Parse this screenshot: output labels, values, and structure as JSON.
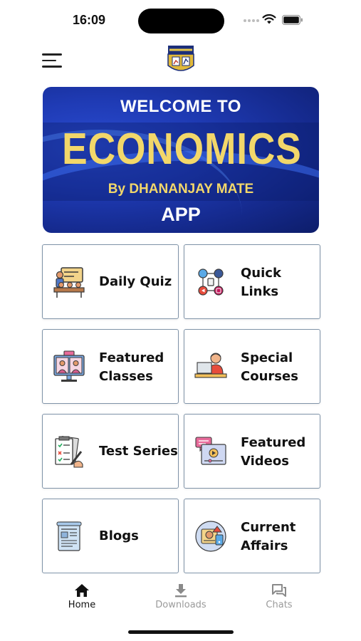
{
  "status_bar": {
    "time": "16:09"
  },
  "banner": {
    "welcome": "WELCOME TO",
    "title": "ECONOMICS",
    "byline": "By DHANANJAY MATE",
    "app": "APP"
  },
  "tiles": [
    {
      "label": "Daily Quiz",
      "icon": "quiz-icon"
    },
    {
      "label": "Quick\nLinks",
      "icon": "links-icon"
    },
    {
      "label": "Featured\nClasses",
      "icon": "classes-icon"
    },
    {
      "label": "Special\nCourses",
      "icon": "courses-icon"
    },
    {
      "label": "Test Series",
      "icon": "test-series-icon"
    },
    {
      "label": "Featured\nVideos",
      "icon": "videos-icon"
    },
    {
      "label": "Blogs",
      "icon": "blogs-icon"
    },
    {
      "label": "Current\nAffairs",
      "icon": "current-affairs-icon"
    }
  ],
  "bottom_nav": {
    "home": "Home",
    "downloads": "Downloads",
    "chats": "Chats",
    "active": "Home"
  },
  "colors": {
    "banner_blue": "#1f3bb5",
    "banner_gold": "#f2d76a",
    "tile_border": "#7f93a8"
  }
}
